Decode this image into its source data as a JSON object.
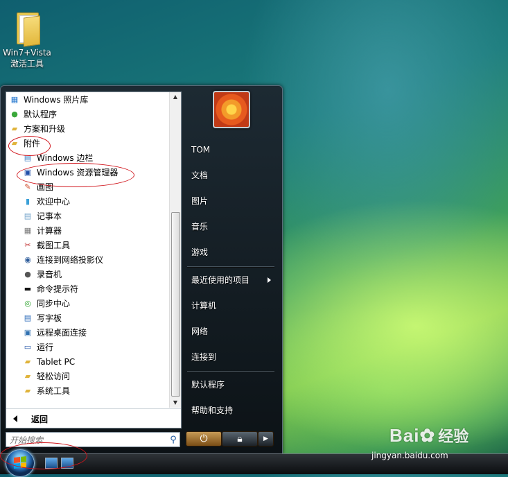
{
  "desktop": {
    "icon_label_line1": "Win7+Vista",
    "icon_label_line2": "激活工具"
  },
  "start_menu": {
    "programs": [
      {
        "label": "Windows 照片库",
        "icon": "photo-gallery-icon",
        "level": 0
      },
      {
        "label": "默认程序",
        "icon": "default-programs-icon",
        "level": 0
      },
      {
        "label": "方案和升级",
        "icon": "folder-icon",
        "level": 0
      },
      {
        "label": "附件",
        "icon": "folder-open-icon",
        "level": 0
      },
      {
        "label": "Windows 边栏",
        "icon": "sidebar-icon",
        "level": 1
      },
      {
        "label": "Windows 资源管理器",
        "icon": "explorer-icon",
        "level": 1
      },
      {
        "label": "画图",
        "icon": "paint-icon",
        "level": 1
      },
      {
        "label": "欢迎中心",
        "icon": "welcome-center-icon",
        "level": 1
      },
      {
        "label": "记事本",
        "icon": "notepad-icon",
        "level": 1
      },
      {
        "label": "计算器",
        "icon": "calculator-icon",
        "level": 1
      },
      {
        "label": "截图工具",
        "icon": "snipping-tool-icon",
        "level": 1
      },
      {
        "label": "连接到网络投影仪",
        "icon": "projector-icon",
        "level": 1
      },
      {
        "label": "录音机",
        "icon": "sound-recorder-icon",
        "level": 1
      },
      {
        "label": "命令提示符",
        "icon": "command-prompt-icon",
        "level": 1
      },
      {
        "label": "同步中心",
        "icon": "sync-center-icon",
        "level": 1
      },
      {
        "label": "写字板",
        "icon": "wordpad-icon",
        "level": 1
      },
      {
        "label": "远程桌面连接",
        "icon": "remote-desktop-icon",
        "level": 1
      },
      {
        "label": "运行",
        "icon": "run-icon",
        "level": 1
      },
      {
        "label": "Tablet PC",
        "icon": "folder-icon",
        "level": 1
      },
      {
        "label": "轻松访问",
        "icon": "folder-icon",
        "level": 1
      },
      {
        "label": "系统工具",
        "icon": "folder-icon",
        "level": 1
      }
    ],
    "back_label": "返回",
    "search_placeholder": "开始搜索",
    "right_items": {
      "user": "TOM",
      "documents": "文档",
      "pictures": "图片",
      "music": "音乐",
      "games": "游戏",
      "recent": "最近使用的项目",
      "computer": "计算机",
      "network": "网络",
      "connect_to": "连接到",
      "default_programs": "默认程序",
      "help": "帮助和支持"
    }
  },
  "watermark": {
    "brand": "Bai",
    "brand_cn": "经验",
    "url": "jingyan.baidu.com"
  },
  "colors": {
    "annotation_red": "#d0141b",
    "menu_dark": "#0c1216"
  }
}
